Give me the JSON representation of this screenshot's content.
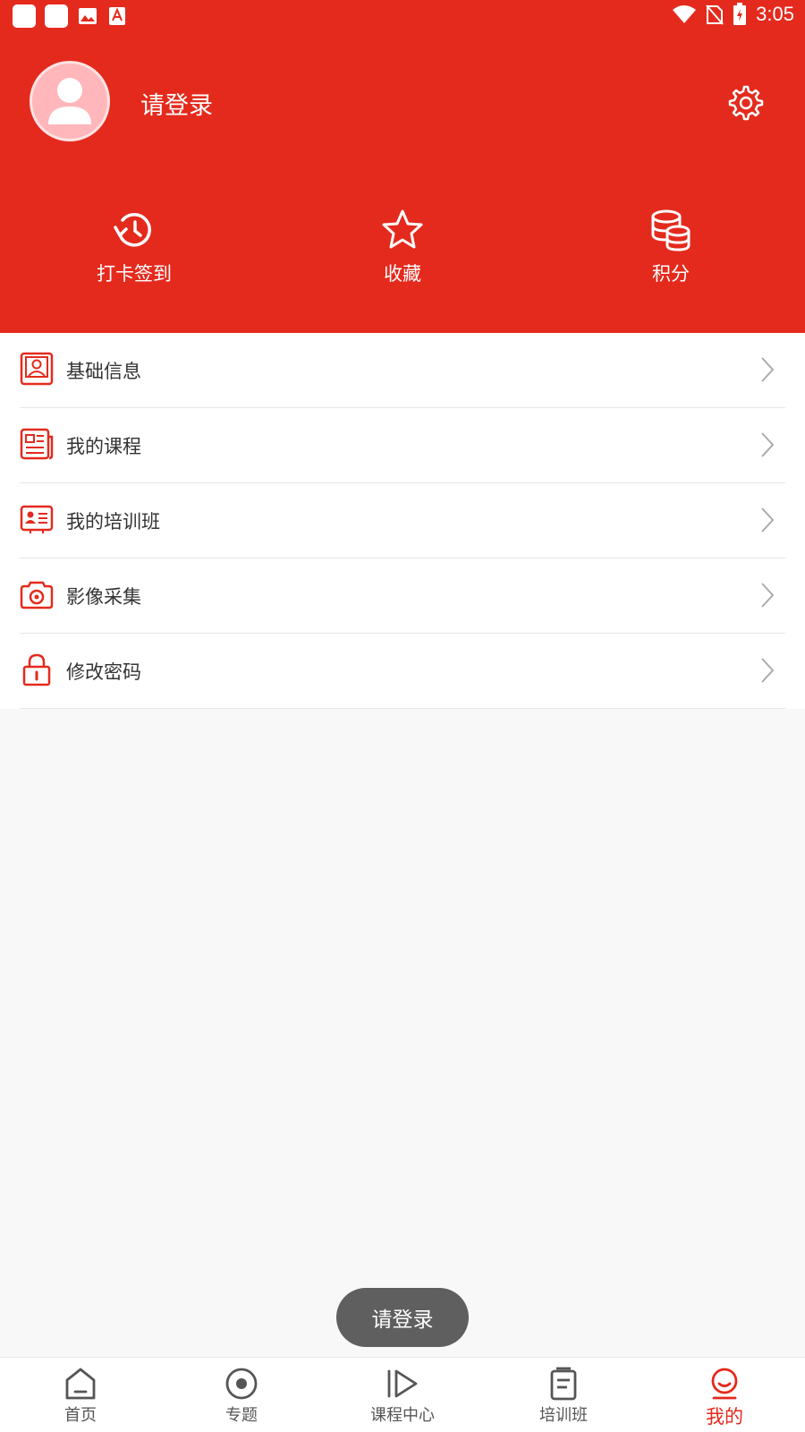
{
  "status_bar": {
    "time": "3:05"
  },
  "profile": {
    "login_text": "请登录"
  },
  "quick_actions": [
    {
      "label": "打卡签到",
      "icon": "history-clock-icon"
    },
    {
      "label": "收藏",
      "icon": "star-icon"
    },
    {
      "label": "积分",
      "icon": "coins-stack-icon"
    }
  ],
  "menu": [
    {
      "label": "基础信息",
      "icon": "profile-card-icon"
    },
    {
      "label": "我的课程",
      "icon": "newspaper-icon"
    },
    {
      "label": "我的培训班",
      "icon": "id-card-icon"
    },
    {
      "label": "影像采集",
      "icon": "camera-icon"
    },
    {
      "label": "修改密码",
      "icon": "lock-icon"
    }
  ],
  "toast": {
    "text": "请登录"
  },
  "tabs": [
    {
      "label": "首页",
      "icon": "home-icon",
      "active": false
    },
    {
      "label": "专题",
      "icon": "topic-circle-icon",
      "active": false
    },
    {
      "label": "课程中心",
      "icon": "play-icon",
      "active": false
    },
    {
      "label": "培训班",
      "icon": "document-icon",
      "active": false
    },
    {
      "label": "我的",
      "icon": "user-face-icon",
      "active": true
    }
  ],
  "colors": {
    "brand_red": "#e42a1d",
    "background": "#f8f8f8",
    "text": "#333333",
    "toast_bg": "#5f5f5f"
  }
}
